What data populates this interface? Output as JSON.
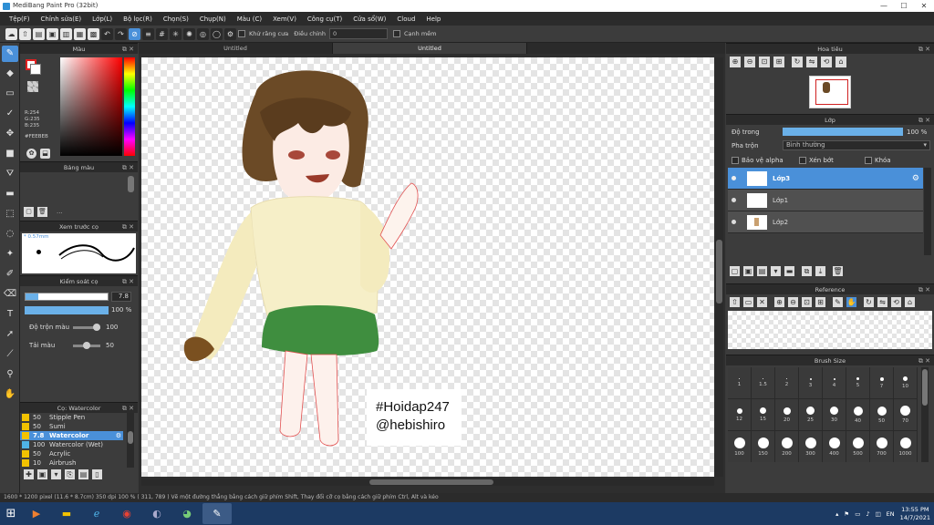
{
  "window": {
    "title": "MediBang Paint Pro (32bit)",
    "min": "—",
    "max": "☐",
    "close": "✕"
  },
  "menu": [
    "Tệp(F)",
    "Chỉnh sửa(E)",
    "Lớp(L)",
    "Bộ lọc(R)",
    "Chọn(S)",
    "Chụp(N)",
    "Màu (C)",
    "Xem(V)",
    "Công cụ(T)",
    "Cửa sổ(W)",
    "Cloud",
    "Help"
  ],
  "toolbar": {
    "antialias_label": "Khử răng cưa",
    "correction_label": "Điều chỉnh",
    "correction_value": "0",
    "soft_edge_label": "Cạnh mềm"
  },
  "color_panel": {
    "title": "Màu",
    "r": "R:254",
    "g": "G:235",
    "b": "B:235",
    "hex": "#FEEBEB",
    "primary": "#e02020",
    "secondary": "#ffffff"
  },
  "palette_panel": {
    "title": "Bảng màu",
    "more": "..."
  },
  "brush_preview": {
    "title": "Xem trước cọ",
    "size": "0.57mm"
  },
  "brush_control": {
    "title": "Kiểm soát cọ",
    "size_value": "7.8",
    "opacity_value": "100 %",
    "blend_label": "Độ trộn màu",
    "blend_value": "100",
    "refill_label": "Tải màu",
    "refill_value": "50"
  },
  "brush_list": {
    "title": "Cọ: Watercolor",
    "items": [
      {
        "size": "50",
        "name": "Stipple Pen",
        "color": "#f2c200",
        "selected": false
      },
      {
        "size": "50",
        "name": "Sumi",
        "color": "#f2c200",
        "selected": false
      },
      {
        "size": "7.8",
        "name": "Watercolor",
        "color": "#f2c200",
        "selected": true
      },
      {
        "size": "100",
        "name": "Watercolor (Wet)",
        "color": "#4fb3e8",
        "selected": false
      },
      {
        "size": "50",
        "name": "Acrylic",
        "color": "#f2c200",
        "selected": false
      },
      {
        "size": "10",
        "name": "Airbrush",
        "color": "#f2c200",
        "selected": false
      }
    ]
  },
  "tabs": [
    "Untitled",
    "Untitled"
  ],
  "canvas": {
    "text_line1": "#Hoidap247",
    "text_line2": "@hebishiro"
  },
  "navigator": {
    "title": "Hoa tiêu"
  },
  "layer_panel": {
    "title": "Lớp",
    "opacity_label": "Độ trong",
    "opacity_value": "100 %",
    "blend_label": "Pha trộn",
    "blend_value": "Bình thường",
    "protect_alpha": "Bảo vệ alpha",
    "clipping": "Xén bớt",
    "lock": "Khóa",
    "layers": [
      {
        "name": "Lớp3",
        "selected": true
      },
      {
        "name": "Lớp1",
        "selected": false
      },
      {
        "name": "Lớp2",
        "selected": false
      }
    ]
  },
  "reference_panel": {
    "title": "Reference"
  },
  "brush_size_panel": {
    "title": "Brush Size",
    "rows": [
      [
        "1",
        "1.5",
        "2",
        "3",
        "4",
        "5",
        "7",
        "10"
      ],
      [
        "12",
        "15",
        "20",
        "25",
        "30",
        "40",
        "50",
        "70"
      ],
      [
        "100",
        "150",
        "200",
        "300",
        "400",
        "500",
        "700",
        "1000"
      ]
    ]
  },
  "statusbar": {
    "text": "1600 * 1200 pixel  (11.6 * 8.7cm)  350 dpi  100 %  ( 311, 789 )  Vẽ một đường thẳng bằng cách giữ phím Shift, Thay đổi cỡ cọ bằng cách giữ phím Ctrl, Alt và kéo"
  },
  "taskbar": {
    "lang": "EN",
    "time": "13:55 PM",
    "date": "14/7/2021"
  }
}
